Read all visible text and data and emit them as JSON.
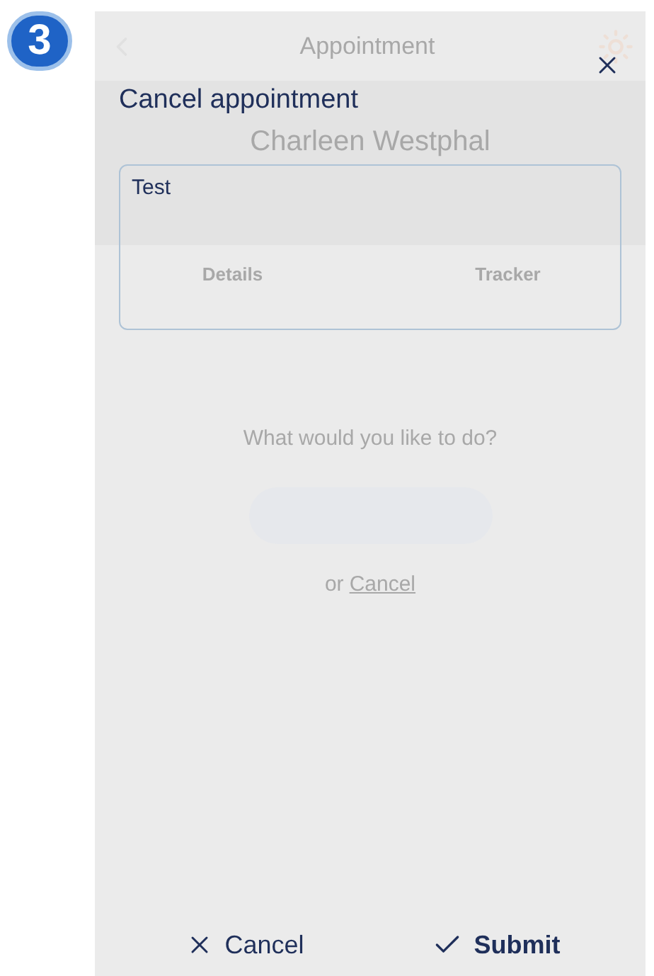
{
  "badge": {
    "number": "3"
  },
  "background_screen": {
    "header": {
      "title": "Appointment"
    },
    "patient": {
      "name": "Charleen Westphal"
    },
    "tabs": [
      {
        "label": "Details"
      },
      {
        "label": "Tracker"
      }
    ],
    "prompt": "What would you like to do?",
    "alternative": {
      "prefix": "or",
      "link": "Cancel"
    }
  },
  "dialog": {
    "title": "Cancel appointment",
    "reason": {
      "value": "Test"
    },
    "actions": [
      {
        "kind": "cancel",
        "label": "Cancel"
      },
      {
        "kind": "submit",
        "label": "Submit"
      }
    ]
  }
}
